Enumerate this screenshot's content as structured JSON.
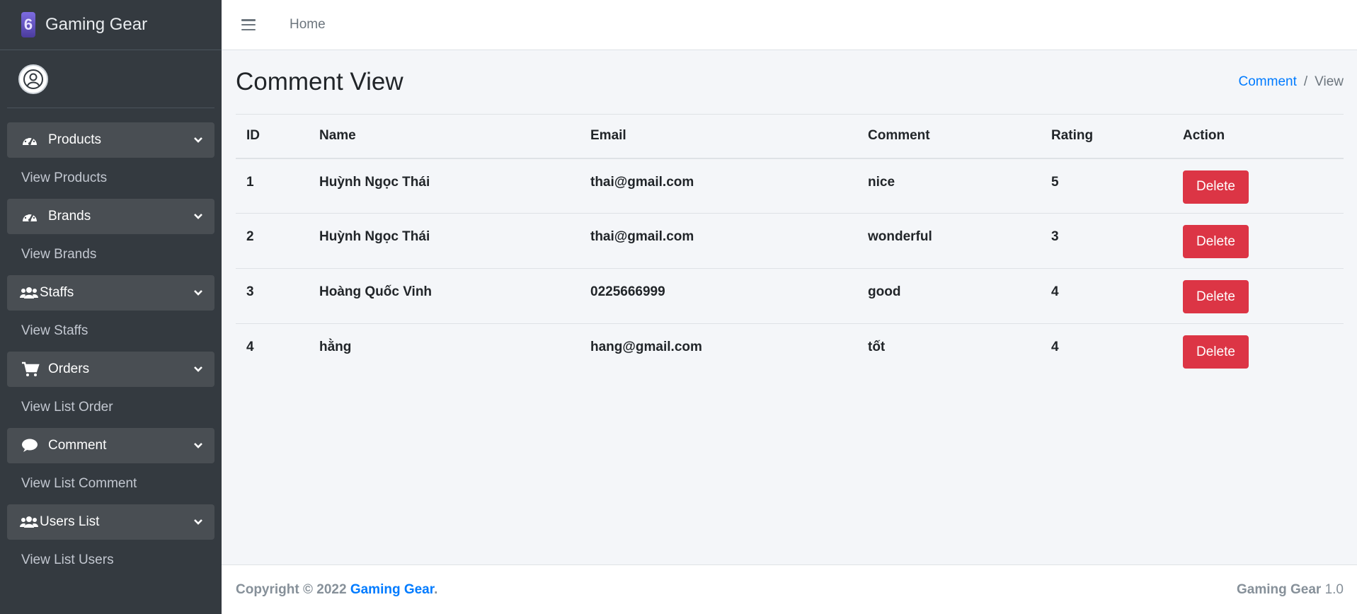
{
  "brand": {
    "name": "Gaming Gear",
    "logo_letter": "6"
  },
  "sidebar": {
    "groups": [
      {
        "label": "Products",
        "icon": "tachometer-icon",
        "sub": "View Products"
      },
      {
        "label": "Brands",
        "icon": "tachometer-icon",
        "sub": "View Brands"
      },
      {
        "label": "Staffs",
        "icon": "users-icon",
        "sub": "View Staffs"
      },
      {
        "label": "Orders",
        "icon": "cart-icon",
        "sub": "View List Order"
      },
      {
        "label": "Comment",
        "icon": "comment-icon",
        "sub": "View List Comment"
      },
      {
        "label": "Users List",
        "icon": "users-icon",
        "sub": "View List Users"
      }
    ]
  },
  "topbar": {
    "home": "Home"
  },
  "page": {
    "title": "Comment View",
    "breadcrumb": {
      "link": "Comment",
      "sep": "/",
      "current": "View"
    }
  },
  "table": {
    "headers": [
      "ID",
      "Name",
      "Email",
      "Comment",
      "Rating",
      "Action"
    ],
    "rows": [
      {
        "id": "1",
        "name": "Huỳnh Ngọc Thái",
        "email": "thai@gmail.com",
        "comment": "nice",
        "rating": "5",
        "action": "Delete"
      },
      {
        "id": "2",
        "name": "Huỳnh Ngọc Thái",
        "email": "thai@gmail.com",
        "comment": "wonderful",
        "rating": "3",
        "action": "Delete"
      },
      {
        "id": "3",
        "name": "Hoàng Quốc Vinh",
        "email": "0225666999",
        "comment": "good",
        "rating": "4",
        "action": "Delete"
      },
      {
        "id": "4",
        "name": "hằng",
        "email": "hang@gmail.com",
        "comment": "tốt",
        "rating": "4",
        "action": "Delete"
      }
    ]
  },
  "footer": {
    "copyright": "Copyright © 2022",
    "link": "Gaming Gear",
    "dot": ".",
    "product": "Gaming Gear",
    "version": "1.0"
  },
  "colors": {
    "sidebar_bg": "#343a40",
    "accent": "#007bff",
    "danger": "#dc3545",
    "content_bg": "#f4f6f9"
  }
}
